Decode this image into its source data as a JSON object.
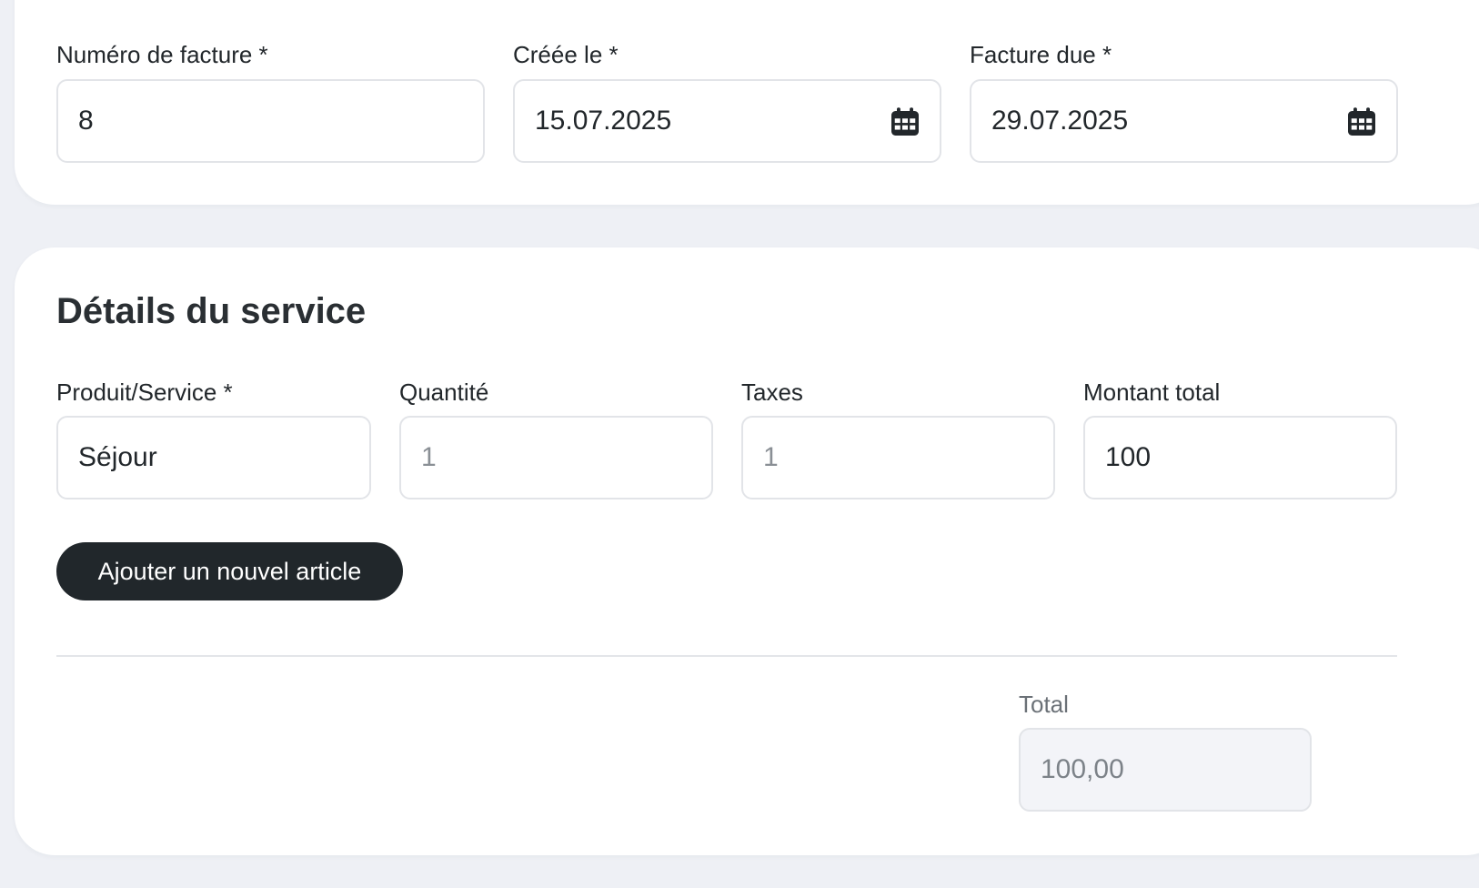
{
  "invoice": {
    "number": {
      "label": "Numéro de facture *",
      "value": "8"
    },
    "created": {
      "label": "Créée le *",
      "value": "15.07.2025",
      "icon": "calendar-icon"
    },
    "due": {
      "label": "Facture due *",
      "value": "29.07.2025",
      "icon": "calendar-icon"
    }
  },
  "service": {
    "title": "Détails du service",
    "product": {
      "label": "Produit/Service *",
      "value": "Séjour"
    },
    "quantity": {
      "label": "Quantité",
      "placeholder": "1"
    },
    "taxes": {
      "label": "Taxes",
      "placeholder": "1"
    },
    "amount": {
      "label": "Montant total",
      "value": "100"
    },
    "add_button": "Ajouter un nouvel article",
    "total": {
      "label": "Total",
      "value": "100,00"
    }
  },
  "colors": {
    "background": "#eef0f5",
    "card": "#ffffff",
    "button": "#21272b",
    "border": "#e2e4e8"
  }
}
